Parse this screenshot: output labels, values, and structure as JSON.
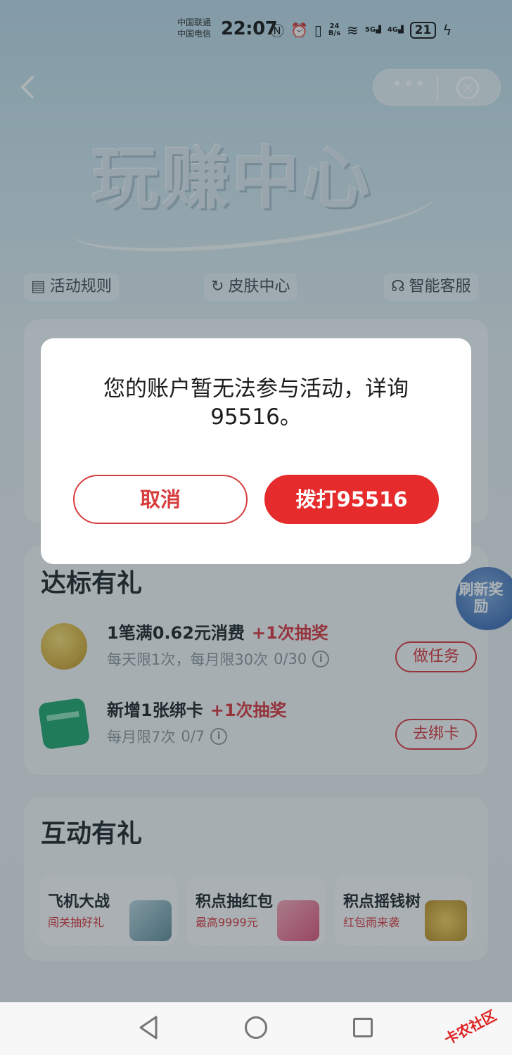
{
  "status_bar": {
    "carrier_1": "中国联通",
    "carrier_2": "中国电信",
    "time": "22:07",
    "net_speed_value": "24",
    "net_speed_unit": "B/s",
    "signal_1": "5G",
    "signal_2": "4G",
    "battery": "21"
  },
  "header": {
    "back_icon": "chevron-left-icon",
    "more_icon": "more-dots-icon",
    "close_icon": "close-circle-icon",
    "hero_title": "玩赚中心"
  },
  "quick_links": [
    {
      "label": "活动规则",
      "icon": "document-icon"
    },
    {
      "label": "皮肤中心",
      "icon": "refresh-icon"
    },
    {
      "label": "智能客服",
      "icon": "headset-icon"
    }
  ],
  "tasks_section": {
    "title": "达标有礼",
    "refresh_badge": "刷新奖励",
    "tasks": [
      {
        "title": "1笔满0.62元消费",
        "bonus": "+1次抽奖",
        "limit": "每天限1次，每月限30次",
        "progress": "0/30",
        "button": "做任务",
        "icon": "coins-icon"
      },
      {
        "title": "新增1张绑卡",
        "bonus": "+1次抽奖",
        "limit": "每月限7次",
        "progress": "0/7",
        "button": "去绑卡",
        "icon": "bank-card-icon"
      }
    ]
  },
  "games_section": {
    "title": "互动有礼",
    "games": [
      {
        "name": "飞机大战",
        "sub": "闯关抽好礼"
      },
      {
        "name": "积点抽红包",
        "sub": "最高9999元"
      },
      {
        "name": "积点摇钱树",
        "sub": "红包雨来袭"
      }
    ]
  },
  "dialog": {
    "message": "您的账户暂无法参与活动，详询95516。",
    "cancel": "取消",
    "call": "拨打95516"
  },
  "watermark": "卡农社区",
  "colors": {
    "primary_red": "#e52b2c",
    "outline_red": "#d83d3d",
    "dim_overlay": "rgba(40,55,64,0.38)"
  }
}
